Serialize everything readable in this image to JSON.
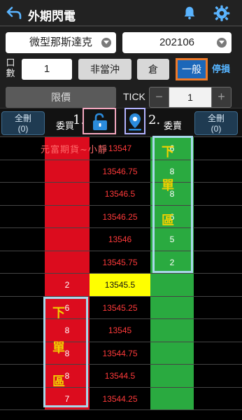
{
  "header": {
    "title": "外期閃電",
    "back_icon": "back-arrow-icon",
    "bell_icon": "bell-icon",
    "gear_icon": "gear-icon"
  },
  "order_panel": {
    "product": "微型那斯達克",
    "month": "202106",
    "qty_label": "口數",
    "qty_value": "1",
    "non_daytrade_label": "非當沖",
    "position_label": "倉",
    "normal_label": "一般",
    "stop_label": "停損",
    "price_type": "限價",
    "tick_label": "TICK",
    "tick_value": "1",
    "minus": "−",
    "plus": "+"
  },
  "ladder_header": {
    "delete_all_left": "全刪",
    "delete_all_left_count": "(0)",
    "delete_all_right": "全刪",
    "delete_all_right_count": "(0)",
    "buy_label": "委買",
    "sell_label": "委賣",
    "note_1": "1.",
    "note_2": "2."
  },
  "watermark": "元富期貨~小靜",
  "annotations": {
    "sell_zone": [
      "下",
      "單",
      "區"
    ],
    "buy_zone": [
      "下",
      "單",
      "區"
    ]
  },
  "ladder": [
    {
      "buy": "",
      "price": "13547",
      "sell": "6"
    },
    {
      "buy": "",
      "price": "13546.75",
      "sell": "8"
    },
    {
      "buy": "",
      "price": "13546.5",
      "sell": "8"
    },
    {
      "buy": "",
      "price": "13546.25",
      "sell": "6"
    },
    {
      "buy": "",
      "price": "13546",
      "sell": "5"
    },
    {
      "buy": "",
      "price": "13545.75",
      "sell": "2"
    },
    {
      "buy": "2",
      "price": "13545.5",
      "sell": ""
    },
    {
      "buy": "6",
      "price": "13545.25",
      "sell": ""
    },
    {
      "buy": "8",
      "price": "13545",
      "sell": ""
    },
    {
      "buy": "8",
      "price": "13544.75",
      "sell": ""
    },
    {
      "buy": "8",
      "price": "13544.5",
      "sell": ""
    },
    {
      "buy": "7",
      "price": "13544.25",
      "sell": ""
    }
  ],
  "current_price_index": 6,
  "colors": {
    "buy_zone": "#dc0c1e",
    "sell_zone": "#2aaa40",
    "current_price": "#ffff00",
    "frame": "#a8d8ea"
  }
}
